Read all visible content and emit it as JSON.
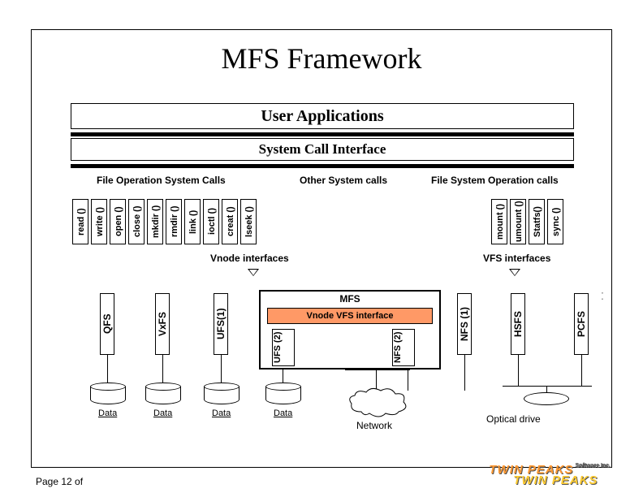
{
  "title": "MFS Framework",
  "layers": {
    "user_apps": "User Applications",
    "sci": "System Call Interface"
  },
  "groups": {
    "file_ops": "File Operation System Calls",
    "other": "Other System calls",
    "fs_ops": "File System Operation calls"
  },
  "syscalls": {
    "file_ops": [
      "read ()",
      "write ()",
      "open ()",
      "close ()",
      "mkdir ()",
      "rmdir ()",
      "link ()",
      "ioctl ()",
      "creat ()",
      "lseek ()"
    ],
    "fs_ops": [
      "mount ()",
      "umount ()",
      "Statfs()",
      "sync ()"
    ]
  },
  "interfaces": {
    "vnode": "Vnode interfaces",
    "vfs": "VFS interfaces"
  },
  "mfs": {
    "title": "MFS",
    "vnode_vfs": "Vnode VFS interface",
    "inner_left": "UFS (2)",
    "inner_right": "NFS (2)"
  },
  "fs_cols": {
    "qfs": "QFS",
    "vxfs": "VxFS",
    "ufs1": "UFS(1)",
    "nfs1": "NFS (1)",
    "hsfs": "HSFS",
    "pcfs": "PCFS"
  },
  "storage": {
    "data": "Data",
    "network": "Network",
    "optical": "Optical drive"
  },
  "page": "Page 12 of",
  "brand": {
    "l1": "TWIN PEAKS",
    "l2": "TWIN PEAKS",
    "sw": "Software Inc."
  }
}
